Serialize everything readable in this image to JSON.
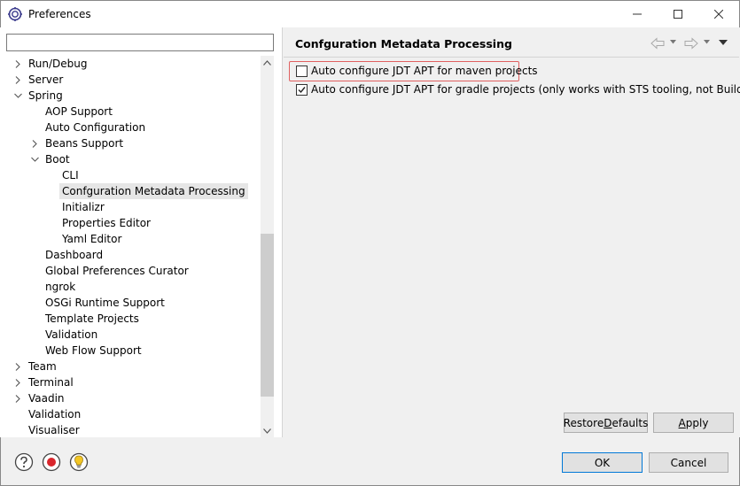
{
  "window": {
    "title": "Preferences",
    "icons": [
      "eclipse-app-icon",
      "minimize-icon",
      "maximize-icon",
      "close-icon"
    ]
  },
  "filter": {
    "value": "",
    "placeholder": ""
  },
  "tree": [
    {
      "label": "Run/Debug",
      "level": 0,
      "expander": "collapsed"
    },
    {
      "label": "Server",
      "level": 0,
      "expander": "collapsed"
    },
    {
      "label": "Spring",
      "level": 0,
      "expander": "expanded"
    },
    {
      "label": "AOP Support",
      "level": 1,
      "expander": "none"
    },
    {
      "label": "Auto Configuration",
      "level": 1,
      "expander": "none"
    },
    {
      "label": "Beans Support",
      "level": 1,
      "expander": "collapsed"
    },
    {
      "label": "Boot",
      "level": 1,
      "expander": "expanded"
    },
    {
      "label": "CLI",
      "level": 2,
      "expander": "none"
    },
    {
      "label": "Confguration Metadata Processing",
      "level": 2,
      "expander": "none",
      "selected": true
    },
    {
      "label": "Initializr",
      "level": 2,
      "expander": "none"
    },
    {
      "label": "Properties Editor",
      "level": 2,
      "expander": "none"
    },
    {
      "label": "Yaml Editor",
      "level": 2,
      "expander": "none"
    },
    {
      "label": "Dashboard",
      "level": 1,
      "expander": "none"
    },
    {
      "label": "Global Preferences Curator",
      "level": 1,
      "expander": "none"
    },
    {
      "label": "ngrok",
      "level": 1,
      "expander": "none"
    },
    {
      "label": "OSGi Runtime Support",
      "level": 1,
      "expander": "none"
    },
    {
      "label": "Template Projects",
      "level": 1,
      "expander": "none"
    },
    {
      "label": "Validation",
      "level": 1,
      "expander": "none"
    },
    {
      "label": "Web Flow Support",
      "level": 1,
      "expander": "none"
    },
    {
      "label": "Team",
      "level": 0,
      "expander": "collapsed"
    },
    {
      "label": "Terminal",
      "level": 0,
      "expander": "collapsed"
    },
    {
      "label": "Vaadin",
      "level": 0,
      "expander": "collapsed"
    },
    {
      "label": "Validation",
      "level": 0,
      "expander": "none"
    },
    {
      "label": "Visualiser",
      "level": 0,
      "expander": "none"
    }
  ],
  "page": {
    "title": "Confguration Metadata Processing",
    "options": [
      {
        "label": "Auto configure JDT APT for maven projects",
        "checked": false,
        "highlighted": true
      },
      {
        "label": "Auto configure JDT APT for gradle projects (only works with STS tooling, not Buildship)",
        "checked": true,
        "highlighted": false
      }
    ]
  },
  "buttons": {
    "restore_pre": "Restore ",
    "restore_mn": "D",
    "restore_post": "efaults",
    "apply_mn": "A",
    "apply_post": "pply",
    "ok": "OK",
    "cancel": "Cancel"
  },
  "colors": {
    "highlight_border": "#e06060",
    "default_button_border": "#0078d7",
    "selection_bg": "#e6e6e6"
  }
}
